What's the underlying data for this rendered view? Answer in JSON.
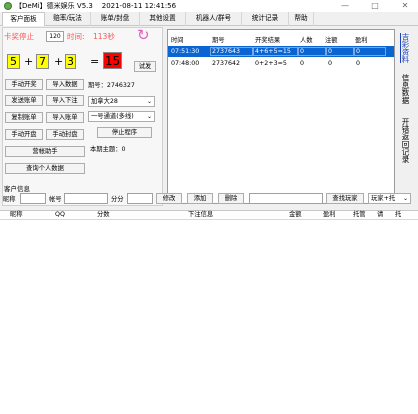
{
  "window": {
    "title": "【DeMi】德米娱乐 V5.3",
    "datetime": "2021-08-11 12:41:56",
    "minimize": "—",
    "maximize": "□",
    "close": "✕"
  },
  "tabs": [
    "客户面板",
    "赔率/玩法",
    "账单/封盘",
    "其他设置",
    "机器人/群号",
    "统计记录",
    "帮助"
  ],
  "lottery": {
    "stop_label": "卡奖停止",
    "stop_value": "120",
    "time_label": "时间:",
    "time_value": "113秒",
    "refresh_icon": "↻",
    "n1": "5",
    "plus1": "+",
    "n2": "7",
    "plus2": "+",
    "n3": "3",
    "equals": "=",
    "result": "15",
    "trial_button": "试发",
    "period_label": "期号：2746327"
  },
  "buttons": {
    "manual_open": "手动开奖",
    "import_data": "导入数据",
    "send_bill": "发送账单",
    "import_bet": "导入下注",
    "copy_bill": "复制账单",
    "import_bill": "导入账单",
    "manual_open_plate": "手动开盘",
    "manual_close_plate": "手动封盘",
    "stop_program": "停止程序",
    "helper": "营帐助手",
    "query_personal": "查询个人数据"
  },
  "selects": {
    "mode": "加拿大28",
    "channel": "一号通道(多线)"
  },
  "current_topic": "本期主题：0",
  "history": {
    "headers": [
      "时间",
      "期号",
      "开奖结果",
      "人数",
      "注额",
      "盈利"
    ],
    "rows": [
      [
        "07:51:30",
        "2737643",
        "4+6+5=15",
        "0",
        "0",
        "0"
      ],
      [
        "07:48:00",
        "2737642",
        "0+2+3=5",
        "0",
        "0",
        "0"
      ]
    ]
  },
  "side_labels": {
    "lottery_info": "吉彩资料",
    "info_data": "信息数据",
    "error_record": "开错返回记录"
  },
  "customer": {
    "section_label": "客户信息",
    "nickname_label": "昵称",
    "account_label": "帐号",
    "points_label": "分分",
    "modify_button": "修改",
    "add_button": "添加",
    "delete_button": "删除",
    "search_button": "查找玩家",
    "player_filter": "玩家+托"
  },
  "player_table": {
    "headers": [
      "昵称",
      "QQ",
      "分数",
      "下注信息",
      "金额",
      "盈利",
      "托管",
      "请",
      "托"
    ]
  }
}
